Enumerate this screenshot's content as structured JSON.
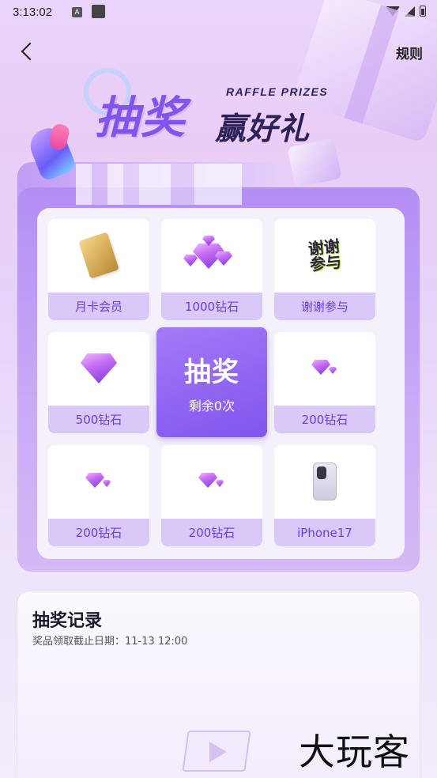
{
  "status_bar": {
    "time": "3:13:02",
    "notif_letter": "A"
  },
  "header": {
    "rules_label": "规则"
  },
  "banner": {
    "title_main": "抽奖",
    "title_sub": "赢好礼",
    "title_en": "RAFFLE PRIZES"
  },
  "prizes": [
    {
      "label": "月卡会员",
      "icon": "card-icon"
    },
    {
      "label": "1000钻石",
      "icon": "gem-cluster-icon"
    },
    {
      "label": "谢谢参与",
      "icon": "thanks-icon",
      "icon_text_1": "谢谢",
      "icon_text_2": "参与"
    },
    {
      "label": "500钻石",
      "icon": "gem-icon"
    },
    {
      "label": "200钻石",
      "icon": "gem-small-icon"
    },
    {
      "label": "200钻石",
      "icon": "gem-small-icon"
    },
    {
      "label": "200钻石",
      "icon": "gem-small-icon"
    },
    {
      "label": "iPhone17",
      "icon": "phone-icon"
    }
  ],
  "draw_button": {
    "title": "抽奖",
    "remaining": "剩余0次"
  },
  "record": {
    "title": "抽奖记录",
    "deadline": "奖品领取截止日期：11-13 12:00"
  },
  "watermark": "大玩客",
  "colors": {
    "accent": "#8254ee",
    "label_bg": "#d8c9f8",
    "label_text": "#6b3fd0"
  }
}
